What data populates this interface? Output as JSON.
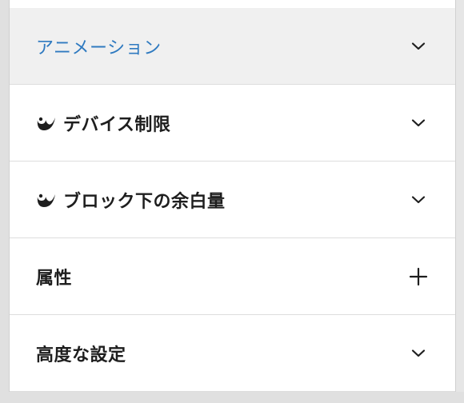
{
  "panel": {
    "sections": [
      {
        "label": "アニメーション",
        "toggle_icon": "chevron-down-icon",
        "has_logo": false,
        "active": true
      },
      {
        "label": "デバイス制限",
        "toggle_icon": "chevron-down-icon",
        "has_logo": true,
        "active": false
      },
      {
        "label": "ブロック下の余白量",
        "toggle_icon": "chevron-down-icon",
        "has_logo": true,
        "active": false
      },
      {
        "label": "属性",
        "toggle_icon": "plus-icon",
        "has_logo": false,
        "active": false
      },
      {
        "label": "高度な設定",
        "toggle_icon": "chevron-down-icon",
        "has_logo": false,
        "active": false
      }
    ]
  },
  "colors": {
    "active_label": "#2f7ac0",
    "active_background": "#f0f0f0",
    "label": "#1e1e1e",
    "divider": "#dddddd"
  }
}
